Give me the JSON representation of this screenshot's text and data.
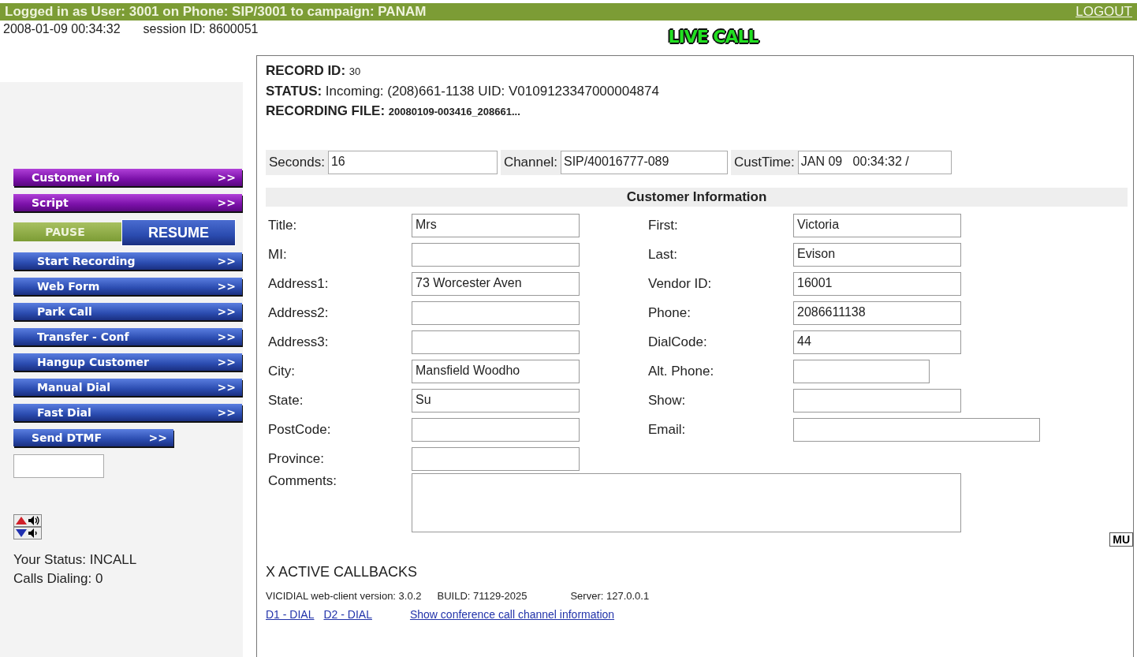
{
  "header": {
    "login_text": "Logged in as User: 3001 on Phone: SIP/3001 to campaign: PANAM",
    "logout": "LOGOUT"
  },
  "datetime": "2008-01-09 00:34:32",
  "session": "session ID: 8600051",
  "live_call": "LIVE CALL",
  "sidebar": {
    "button_groups": [
      [
        {
          "kind": "purple",
          "label": "Customer Info",
          "arrow": ">>"
        },
        {
          "kind": "purple",
          "label": "Script",
          "arrow": ">>"
        },
        {
          "kind": "pause_resume",
          "pause": "PAUSE",
          "resume": "RESUME"
        },
        {
          "kind": "blue",
          "label": "Start Recording",
          "arrow": ">>"
        },
        {
          "kind": "blue",
          "label": "Web Form",
          "arrow": ">>"
        }
      ],
      [
        {
          "kind": "blue",
          "label": "Park Call",
          "arrow": ">>"
        },
        {
          "kind": "blue",
          "label": "Transfer - Conf",
          "arrow": ">>"
        }
      ],
      [
        {
          "kind": "blue",
          "label": "Hangup Customer",
          "arrow": ">>"
        }
      ],
      [
        {
          "kind": "blue",
          "label": "Manual Dial",
          "arrow": ">>"
        },
        {
          "kind": "blue",
          "label": "Fast Dial",
          "arrow": ">>"
        },
        {
          "kind": "short",
          "label": "Send DTMF",
          "arrow": ">>"
        }
      ]
    ],
    "status": "Your Status: INCALL",
    "calls_dialing": "Calls Dialing: 0"
  },
  "record": {
    "record_id_label": "RECORD ID:",
    "record_id": "30",
    "status_label": "STATUS:",
    "status": "Incoming: (208)661-1138 UID: V0109123347000004874",
    "file_label": "RECORDING FILE:",
    "file": "20080109-003416_208661..."
  },
  "call_fields": [
    {
      "label": "Seconds:",
      "value": "16"
    },
    {
      "label": "Channel:",
      "value": "SIP/40016777-089"
    },
    {
      "label": "CustTime:",
      "value": "JAN 09   00:34:32 /"
    }
  ],
  "customer_info": {
    "heading": "Customer Information",
    "left": [
      {
        "label": "Title:",
        "value": "Mrs"
      },
      {
        "label": "MI:"
      },
      {
        "label": "Address1:",
        "value": "73 Worcester Aven"
      },
      {
        "label": "Address2:"
      },
      {
        "label": "Address3:"
      },
      {
        "label": "City:",
        "value": "Mansfield Woodho"
      },
      {
        "label": "State:",
        "value": "Su"
      },
      {
        "label": "PostCode:"
      },
      {
        "label": "Province:"
      }
    ],
    "right": [
      {
        "label": "First:",
        "value": "Victoria"
      },
      {
        "label": "Last:",
        "value": "Evison"
      },
      {
        "label": "Vendor ID:",
        "value": "16001"
      },
      {
        "label": "Phone:",
        "value": "2086611138"
      },
      {
        "label": "DialCode:",
        "value": "44"
      },
      {
        "label": "Alt. Phone:"
      },
      {
        "label": "Show:"
      },
      {
        "label": "Email:"
      }
    ],
    "comments_label": "Comments:"
  },
  "mute_button": "MU",
  "callbacks": "X ACTIVE CALLBACKS",
  "version": {
    "client": "VICIDIAL web-client version: 3.0.2",
    "build": "BUILD: 71129-2025",
    "server": "Server: 127.0.0.1"
  },
  "links": [
    "D1 - DIAL",
    "D2 - DIAL",
    "Show conference call channel information"
  ]
}
